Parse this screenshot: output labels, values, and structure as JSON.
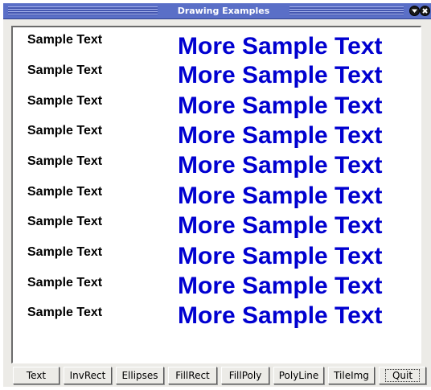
{
  "window": {
    "title": "Drawing Examples"
  },
  "icons": {
    "shade": "shade-down-icon",
    "close": "close-icon"
  },
  "canvas": {
    "rows": [
      {
        "left": "Sample Text",
        "right": "More Sample Text"
      },
      {
        "left": "Sample Text",
        "right": "More Sample Text"
      },
      {
        "left": "Sample Text",
        "right": "More Sample Text"
      },
      {
        "left": "Sample Text",
        "right": "More Sample Text"
      },
      {
        "left": "Sample Text",
        "right": "More Sample Text"
      },
      {
        "left": "Sample Text",
        "right": "More Sample Text"
      },
      {
        "left": "Sample Text",
        "right": "More Sample Text"
      },
      {
        "left": "Sample Text",
        "right": "More Sample Text"
      },
      {
        "left": "Sample Text",
        "right": "More Sample Text"
      },
      {
        "left": "Sample Text",
        "right": "More Sample Text"
      }
    ],
    "left_color": "#000000",
    "right_color": "#0000d0"
  },
  "buttons": [
    {
      "label": "Text"
    },
    {
      "label": "InvRect"
    },
    {
      "label": "Ellipses"
    },
    {
      "label": "FillRect"
    },
    {
      "label": "FillPoly"
    },
    {
      "label": "PolyLine"
    },
    {
      "label": "TileImg"
    },
    {
      "label": "Quit"
    }
  ]
}
